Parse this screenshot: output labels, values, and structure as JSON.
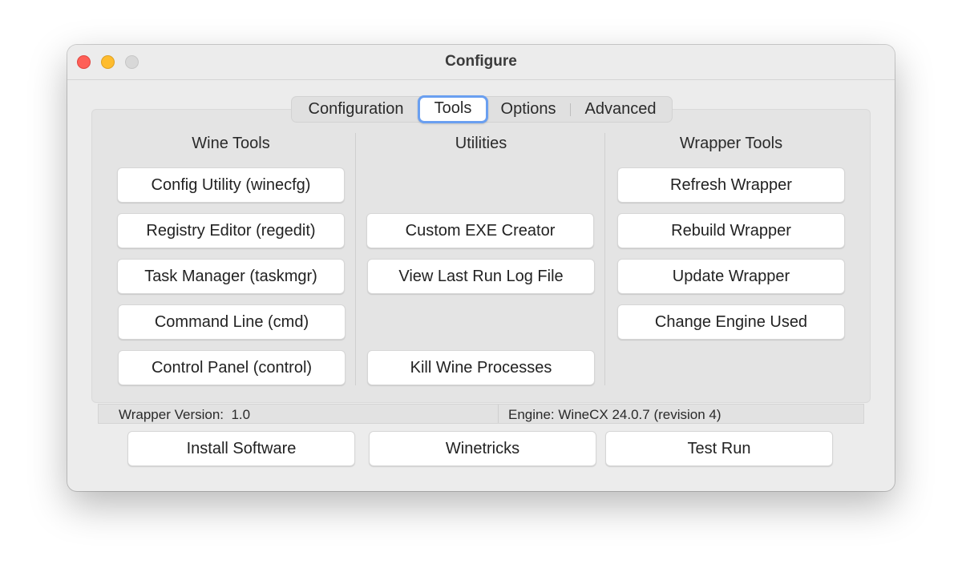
{
  "window": {
    "title": "Configure"
  },
  "tabs": [
    {
      "label": "Configuration"
    },
    {
      "label": "Tools",
      "selected": true
    },
    {
      "label": "Options"
    },
    {
      "label": "Advanced"
    }
  ],
  "columns": {
    "wine_tools": {
      "heading": "Wine Tools",
      "buttons": [
        "Config Utility (winecfg)",
        "Registry Editor (regedit)",
        "Task Manager (taskmgr)",
        "Command Line (cmd)",
        "Control Panel (control)"
      ]
    },
    "utilities": {
      "heading": "Utilities",
      "buttons": [
        "Custom EXE Creator",
        "View Last Run Log File",
        "Kill Wine Processes"
      ]
    },
    "wrapper_tools": {
      "heading": "Wrapper Tools",
      "buttons": [
        "Refresh Wrapper",
        "Rebuild Wrapper",
        "Update Wrapper",
        "Change Engine Used"
      ]
    }
  },
  "status": {
    "wrapper_version": "Wrapper Version:  1.0",
    "engine": "Engine: WineCX 24.0.7 (revision 4)"
  },
  "bottom_buttons": [
    "Install Software",
    "Winetricks",
    "Test Run"
  ],
  "colors": {
    "close": "#fe5f57",
    "minimize": "#febc2e",
    "zoom_disabled": "#d8d8d8",
    "focus_ring": "#6a9ff0"
  }
}
